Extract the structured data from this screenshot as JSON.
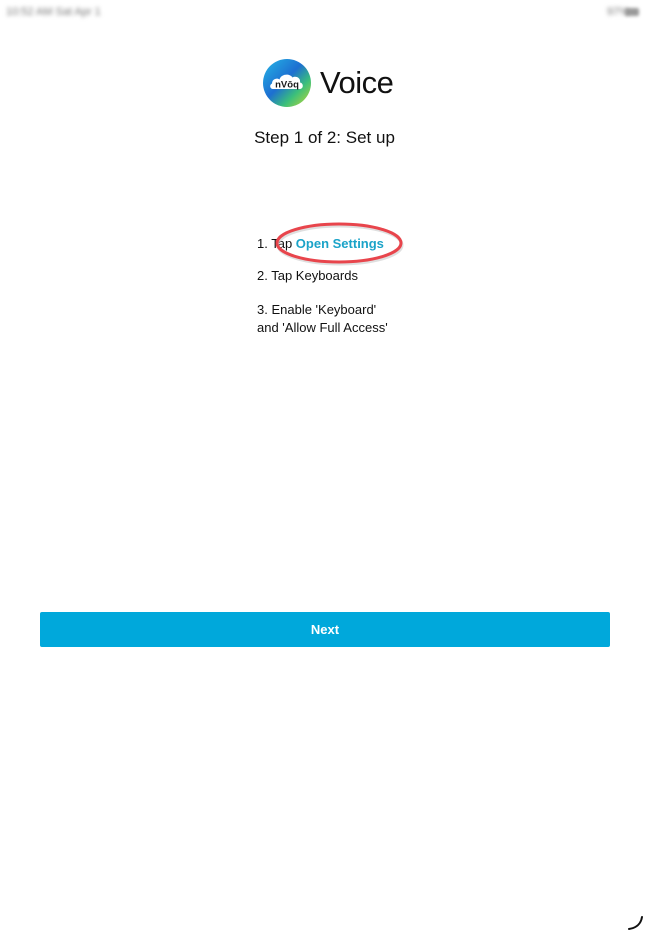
{
  "status_bar": {
    "left_text": "10:52 AM  Sat Apr 1",
    "right_text": "97% "
  },
  "logo": {
    "brand": "nVōq",
    "app_name": "Voice"
  },
  "step_title": "Step 1 of 2: Set up",
  "instructions": {
    "item1_prefix": "1. Tap ",
    "item1_link": "Open Settings",
    "item2": "2. Tap Keyboards",
    "item3_line1": "3. Enable 'Keyboard'",
    "item3_line2": "and 'Allow Full Access'"
  },
  "next_button": {
    "label": "Next",
    "color": "#00a8db"
  },
  "colors": {
    "link": "#1aa3c8",
    "annotation_circle": "#e8454c"
  },
  "icons": [
    "nvoq-logo-icon",
    "battery-icon",
    "highlight-circle",
    "resize-icon"
  ]
}
